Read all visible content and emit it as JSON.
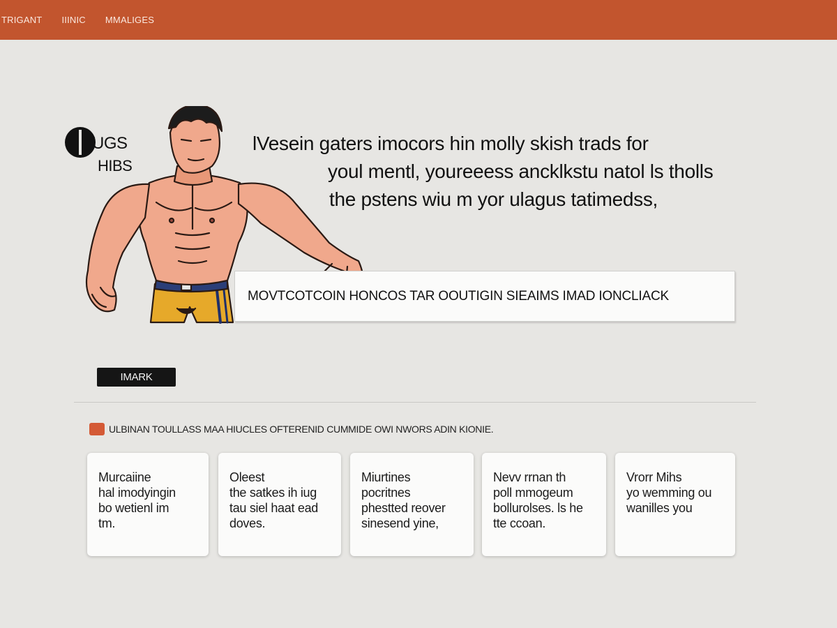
{
  "nav": {
    "items": [
      "TRIGANT",
      "IIINIC",
      "MMALIGES"
    ]
  },
  "logo": {
    "word": "UGS",
    "sub": "HIBS"
  },
  "hero": {
    "headline_lines": [
      "lVesein gaters imocors hin molly skish trads for",
      "youl mentl, youreeess ancklkstu natol ls tholls",
      "the pstens wiu m yor ulagus tatimedss,"
    ],
    "banner_text": "MOVTCOTCOIN HONCOS TAR OOUTIGIN SIEAIMS IMAD IONCLIACK"
  },
  "action": {
    "mark_label": "IMARK"
  },
  "section": {
    "label": "ULBINAN TOULLASS MAA HIUCLES OFTERENID CUMMIDE OWI NWORS ADIN KIONIE."
  },
  "cards": [
    {
      "lines": [
        "Murcaiine",
        "hal imodyingin",
        "bo wetienl im",
        "tm."
      ]
    },
    {
      "lines": [
        "Oleest",
        "the satkes ih iug",
        "tau siel haat ead",
        "doves."
      ]
    },
    {
      "lines": [
        "Miurtines",
        "pocritnes",
        "phestted reover",
        "sinesend yine,"
      ]
    },
    {
      "lines": [
        "Nevv rrnan th",
        "poll mmogeum",
        "bollurolses. ls he",
        "tte ccoan."
      ]
    },
    {
      "lines": [
        "Vrorr Mihs",
        "yo wemming ou",
        "wanilles you"
      ]
    }
  ],
  "colors": {
    "topbar": "#c2552e",
    "accent": "#d45a36",
    "background": "#e7e6e3"
  }
}
